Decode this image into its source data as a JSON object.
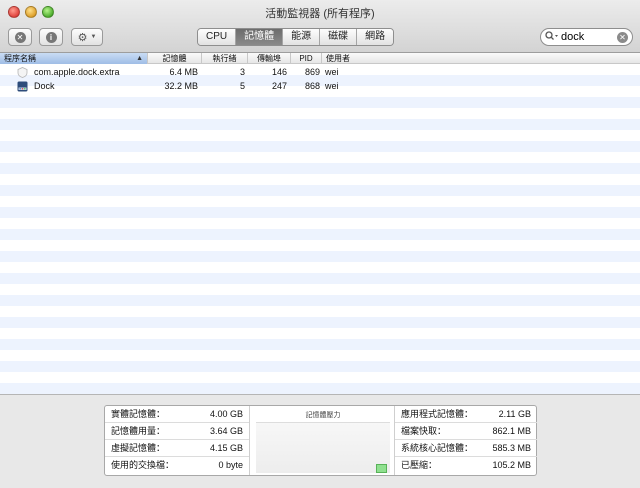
{
  "window": {
    "title": "活動監視器 (所有程序)"
  },
  "toolbar": {
    "stop_icon": "x-circle-icon",
    "info_icon": "info-circle-icon",
    "gear_icon": "gear-icon",
    "tabs": [
      {
        "label": "CPU",
        "active": false
      },
      {
        "label": "記憶體",
        "active": true
      },
      {
        "label": "能源",
        "active": false
      },
      {
        "label": "磁碟",
        "active": false
      },
      {
        "label": "網路",
        "active": false
      }
    ],
    "search": {
      "value": "dock",
      "placeholder": ""
    }
  },
  "table": {
    "columns": [
      {
        "label": "程序名稱",
        "sorted": true
      },
      {
        "label": "記憶體"
      },
      {
        "label": "執行緒"
      },
      {
        "label": "傳輸埠"
      },
      {
        "label": "PID"
      },
      {
        "label": "使用者"
      }
    ],
    "rows": [
      {
        "name": "com.apple.dock.extra",
        "memory": "6.4 MB",
        "threads": "3",
        "ports": "146",
        "pid": "869",
        "user": "wei",
        "icon": "generic-process-icon"
      },
      {
        "name": "Dock",
        "memory": "32.2 MB",
        "threads": "5",
        "ports": "247",
        "pid": "868",
        "user": "wei",
        "icon": "dock-icon"
      }
    ]
  },
  "memory_stats": {
    "left": [
      {
        "label": "實體記憶體：",
        "value": "4.00 GB"
      },
      {
        "label": "記憶體用量：",
        "value": "3.64 GB"
      },
      {
        "label": "虛擬記憶體：",
        "value": "4.15 GB"
      },
      {
        "label": "使用的交換檔：",
        "value": "0 byte"
      }
    ],
    "pressure_title": "記憶體壓力",
    "right": [
      {
        "label": "應用程式記憶體：",
        "value": "2.11 GB"
      },
      {
        "label": "檔案快取：",
        "value": "862.1 MB"
      },
      {
        "label": "系統核心記憶體：",
        "value": "585.3 MB"
      },
      {
        "label": "已壓縮：",
        "value": "105.2 MB"
      }
    ]
  },
  "colors": {
    "selection": "#9fbde6",
    "pressure_green": "#8fe08f",
    "row_alt": "#edf3fe"
  }
}
